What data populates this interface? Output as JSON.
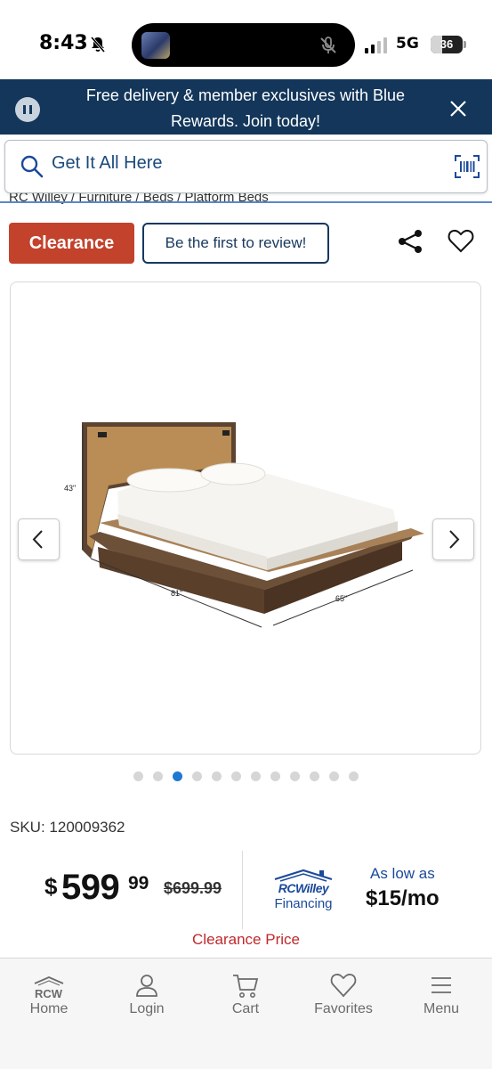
{
  "status_bar": {
    "time": "8:43",
    "network": "5G",
    "battery": "36",
    "battery_fraction": 0.36
  },
  "banner": {
    "text": "Free delivery & member exclusives with Blue Rewards. Join today!"
  },
  "search": {
    "placeholder": "Get It All Here"
  },
  "breadcrumb": "RC Willey / Furniture / Beds / Platform Beds",
  "product": {
    "clearance_badge": "Clearance",
    "review_button": "Be the first to review!",
    "image_dimensions": {
      "height": "43\"",
      "length": "81\"",
      "width": "65\""
    },
    "image_count": 12,
    "active_image_index": 2,
    "sku_label": "SKU:",
    "sku_value": "120009362",
    "price_dollar_sign": "$",
    "price_whole": "599",
    "price_cents": "99",
    "price_old": "$699.99",
    "financing_brand": "RCWilley",
    "financing_label": "Financing",
    "as_low_as_label": "As low as",
    "as_low_as_amount": "$15/mo",
    "clearance_price_label": "Clearance Price"
  },
  "bottom_nav": {
    "home_logo": "RCW",
    "items": [
      {
        "label": "Home",
        "icon": "home-icon"
      },
      {
        "label": "Login",
        "icon": "user-icon"
      },
      {
        "label": "Cart",
        "icon": "cart-icon"
      },
      {
        "label": "Favorites",
        "icon": "heart-icon"
      },
      {
        "label": "Menu",
        "icon": "menu-icon"
      }
    ]
  },
  "colors": {
    "banner_bg": "#13365a",
    "clearance_red": "#c2422c",
    "link_blue": "#1b4a9a",
    "dot_active": "#1f78d1"
  }
}
